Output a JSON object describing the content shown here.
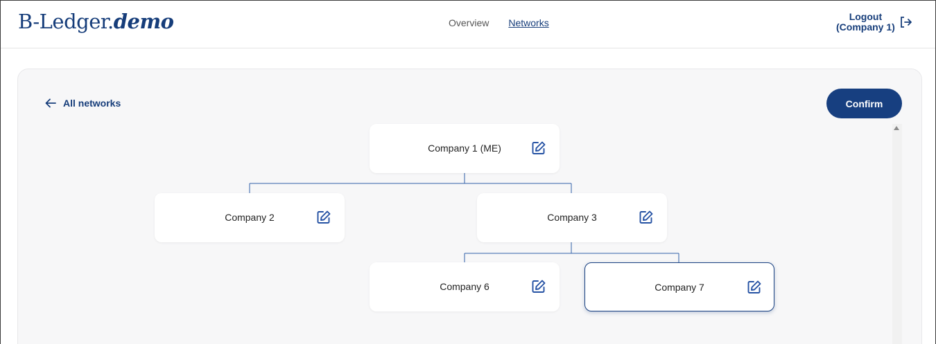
{
  "header": {
    "logo_main": "B-Ledger.",
    "logo_em": "demo",
    "nav": [
      {
        "label": "Overview",
        "active": false
      },
      {
        "label": "Networks",
        "active": true
      }
    ],
    "logout_line1": "Logout",
    "logout_line2": "(Company 1)"
  },
  "toolbar": {
    "back_label": "All networks",
    "confirm_label": "Confirm"
  },
  "tree": {
    "nodes": [
      {
        "label": "Company 1 (ME)",
        "selected": false
      },
      {
        "label": "Company 2",
        "selected": false
      },
      {
        "label": "Company 3",
        "selected": false
      },
      {
        "label": "Company 6",
        "selected": false
      },
      {
        "label": "Company 7",
        "selected": true
      }
    ]
  },
  "colors": {
    "brand": "#163d7a",
    "button": "#173f80",
    "line": "#2f5fa8"
  },
  "icons": {
    "logout": "logout-icon",
    "back": "arrow-left-icon",
    "edit": "edit-icon"
  }
}
